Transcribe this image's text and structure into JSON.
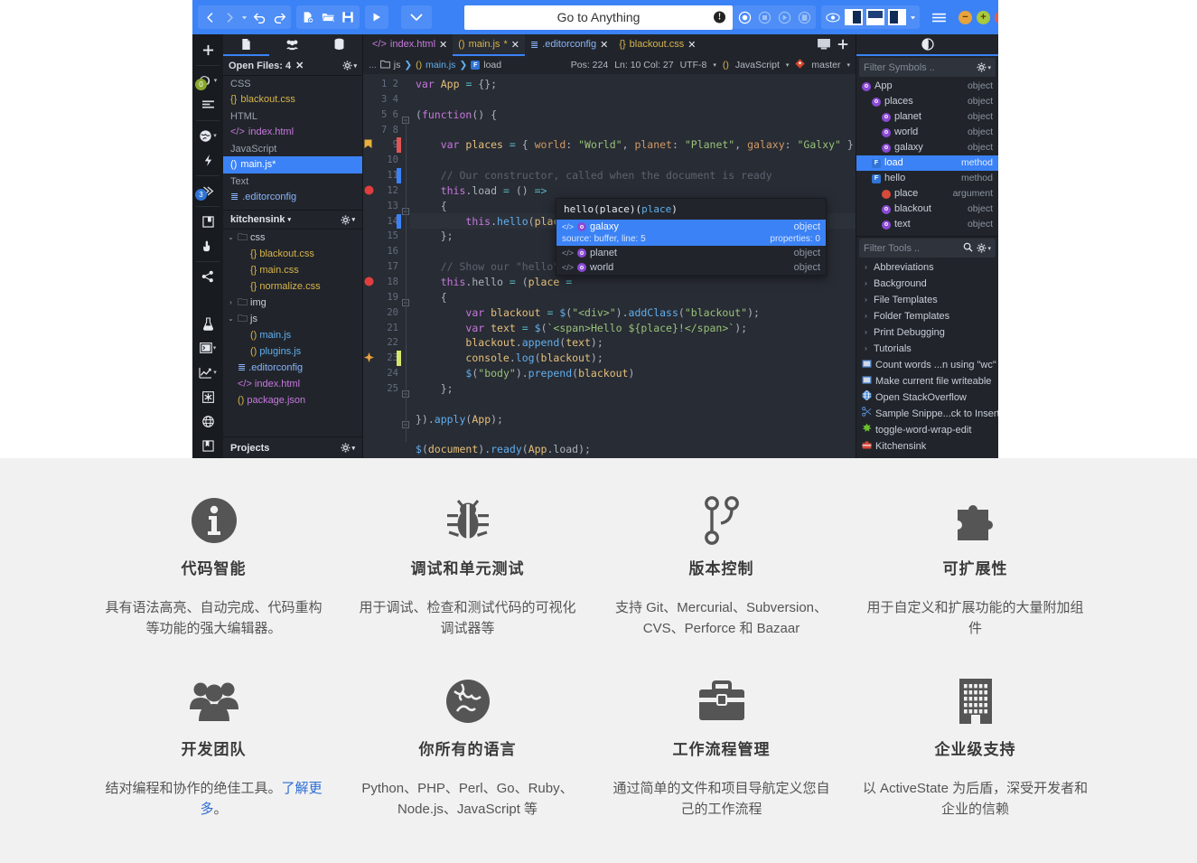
{
  "ide": {
    "toolbar": {
      "back": "back-arrow",
      "forward": "forward-arrow",
      "undo": "undo",
      "redo": "redo",
      "new_file": "new-file",
      "open_file": "open-folder",
      "save": "save",
      "run": "run",
      "goto_placeholder": "Go to Anything",
      "goto_text": "Go to Anything"
    },
    "left_panel": {
      "tabs": [
        "places-tab",
        "collaboration-tab",
        "database-tab"
      ],
      "open_files_header": "Open Files: 4",
      "groups": [
        {
          "label": "CSS",
          "items": [
            {
              "name": "blackout.css",
              "type": "css"
            }
          ]
        },
        {
          "label": "HTML",
          "items": [
            {
              "name": "index.html",
              "type": "html"
            }
          ]
        },
        {
          "label": "JavaScript",
          "items": [
            {
              "name": "main.js*",
              "type": "js",
              "selected": true
            }
          ]
        },
        {
          "label": "Text",
          "items": [
            {
              "name": ".editorconfig",
              "type": "txt"
            }
          ]
        }
      ],
      "project_name": "kitchensink",
      "tree": [
        {
          "indent": 0,
          "twisty": "v",
          "name": "css",
          "type": "folder"
        },
        {
          "indent": 1,
          "twisty": "",
          "name": "blackout.css",
          "type": "css"
        },
        {
          "indent": 1,
          "twisty": "",
          "name": "main.css",
          "type": "css"
        },
        {
          "indent": 1,
          "twisty": "",
          "name": "normalize.css",
          "type": "css"
        },
        {
          "indent": 0,
          "twisty": ">",
          "name": "img",
          "type": "folder"
        },
        {
          "indent": 0,
          "twisty": "v",
          "name": "js",
          "type": "folder"
        },
        {
          "indent": 1,
          "twisty": "",
          "name": "main.js",
          "type": "js"
        },
        {
          "indent": 1,
          "twisty": "",
          "name": "plugins.js",
          "type": "js"
        },
        {
          "indent": 0,
          "twisty": "",
          "name": ".editorconfig",
          "type": "txt"
        },
        {
          "indent": 0,
          "twisty": "",
          "name": "index.html",
          "type": "html"
        },
        {
          "indent": 0,
          "twisty": "",
          "name": "package.json",
          "type": "json"
        }
      ],
      "projects_label": "Projects"
    },
    "tabs": [
      {
        "label": "index.html",
        "type": "html",
        "active": false,
        "modified": false
      },
      {
        "label": "main.js",
        "type": "js",
        "active": true,
        "modified": true
      },
      {
        "label": ".editorconfig",
        "type": "txt",
        "active": false,
        "modified": false
      },
      {
        "label": "blackout.css",
        "type": "css",
        "active": false,
        "modified": false
      }
    ],
    "breadcrumb": [
      "...",
      "js",
      "main.js",
      "load"
    ],
    "status": {
      "pos": "Pos: 224",
      "line_col": "Ln: 10 Col: 27",
      "encoding": "UTF-8",
      "language": "JavaScript",
      "branch": "master"
    },
    "code": {
      "first_line": 1,
      "total_lines": 25,
      "lines": [
        "var App = {};",
        "",
        "(function() {",
        "",
        "    var places = { world: \"World\", planet: \"Planet\", galaxy: \"Galxy\" };",
        "",
        "    // Our constructor, called when the document is ready",
        "    this.load = () =>",
        "    {",
        "        this.hello(places.);",
        "    };",
        "",
        "    // Show our \"hello\" bl",
        "    this.hello = (place =",
        "    {",
        "        var blackout = $(\"<div>\").addClass(\"blackout\");",
        "        var text = $(`<span>Hello ${place}!</span>`);",
        "        blackout.append(text);",
        "        console.log(blackout);",
        "        $(\"body\").prepend(blackout)",
        "    };",
        "",
        "}).apply(App);",
        "",
        "$(document).ready(App.load);"
      ]
    },
    "autocomplete": {
      "calltip": "hello(place)",
      "items": [
        {
          "name": "galaxy",
          "kind": "object",
          "selected": true,
          "source": "source: buffer, line: 5",
          "properties": "properties: 0"
        },
        {
          "name": "planet",
          "kind": "object",
          "selected": false
        },
        {
          "name": "world",
          "kind": "object",
          "selected": false
        }
      ]
    },
    "right_panel": {
      "symbols_filter_placeholder": "Filter Symbols ..",
      "symbols": [
        {
          "indent": 0,
          "name": "App",
          "kind": "object",
          "icon": "O"
        },
        {
          "indent": 1,
          "name": "places",
          "kind": "object",
          "icon": "O"
        },
        {
          "indent": 2,
          "name": "planet",
          "kind": "object",
          "icon": "O"
        },
        {
          "indent": 2,
          "name": "world",
          "kind": "object",
          "icon": "O"
        },
        {
          "indent": 2,
          "name": "galaxy",
          "kind": "object",
          "icon": "O"
        },
        {
          "indent": 1,
          "name": "load",
          "kind": "method",
          "icon": "F",
          "selected": true
        },
        {
          "indent": 1,
          "name": "hello",
          "kind": "method",
          "icon": "F"
        },
        {
          "indent": 2,
          "name": "place",
          "kind": "argument",
          "icon": "A"
        },
        {
          "indent": 2,
          "name": "blackout",
          "kind": "object",
          "icon": "O"
        },
        {
          "indent": 2,
          "name": "text",
          "kind": "object",
          "icon": "O"
        }
      ],
      "tools_filter_placeholder": "Filter Tools ..",
      "tools": [
        {
          "name": "Abbreviations",
          "twisty": true
        },
        {
          "name": "Background",
          "twisty": true
        },
        {
          "name": "File Templates",
          "twisty": true
        },
        {
          "name": "Folder Templates",
          "twisty": true
        },
        {
          "name": "Print Debugging",
          "twisty": true
        },
        {
          "name": "Tutorials",
          "twisty": true
        },
        {
          "name": "Count words ...n using \"wc\"",
          "twisty": false,
          "icon": "macro"
        },
        {
          "name": "Make current file writeable",
          "twisty": false,
          "icon": "macro"
        },
        {
          "name": "Open StackOverflow",
          "twisty": false,
          "icon": "url"
        },
        {
          "name": "Sample Snippe...ck to Insert",
          "twisty": false,
          "icon": "snippet"
        },
        {
          "name": "toggle-word-wrap-edit",
          "twisty": false,
          "icon": "command"
        },
        {
          "name": "Kitchensink",
          "twisty": false,
          "icon": "toolbox"
        }
      ]
    }
  },
  "features": [
    {
      "icon": "info-icon",
      "title": "代码智能",
      "desc": "具有语法高亮、自动完成、代码重构等功能的强大编辑器。"
    },
    {
      "icon": "bug-icon",
      "title": "调试和单元测试",
      "desc": "用于调试、检查和测试代码的可视化调试器等"
    },
    {
      "icon": "branch-icon",
      "title": "版本控制",
      "desc": "支持 Git、Mercurial、Subversion、CVS、Perforce 和 Bazaar"
    },
    {
      "icon": "puzzle-icon",
      "title": "可扩展性",
      "desc": "用于自定义和扩展功能的大量附加组件"
    },
    {
      "icon": "team-icon",
      "title": "开发团队",
      "desc": "结对编程和协作的绝佳工具。",
      "link_text": "了解更多",
      "desc_tail": "。"
    },
    {
      "icon": "globe-icon",
      "title": "你所有的语言",
      "desc": "Python、PHP、Perl、Go、Ruby、Node.js、JavaScript 等"
    },
    {
      "icon": "briefcase-icon",
      "title": "工作流程管理",
      "desc": "通过简单的文件和项目导航定义您自己的工作流程"
    },
    {
      "icon": "building-icon",
      "title": "企业级支持",
      "desc": "以 ActiveState 为后盾，深受开发者和企业的信赖"
    }
  ],
  "colors": {
    "accent": "#3b82f6",
    "titlebar": "#3b82f6",
    "editor_bg": "#282c34",
    "panel_bg": "#21252b",
    "features_bg": "#f1f1f1",
    "icon_gray": "#555555",
    "link": "#2b6cd4"
  }
}
